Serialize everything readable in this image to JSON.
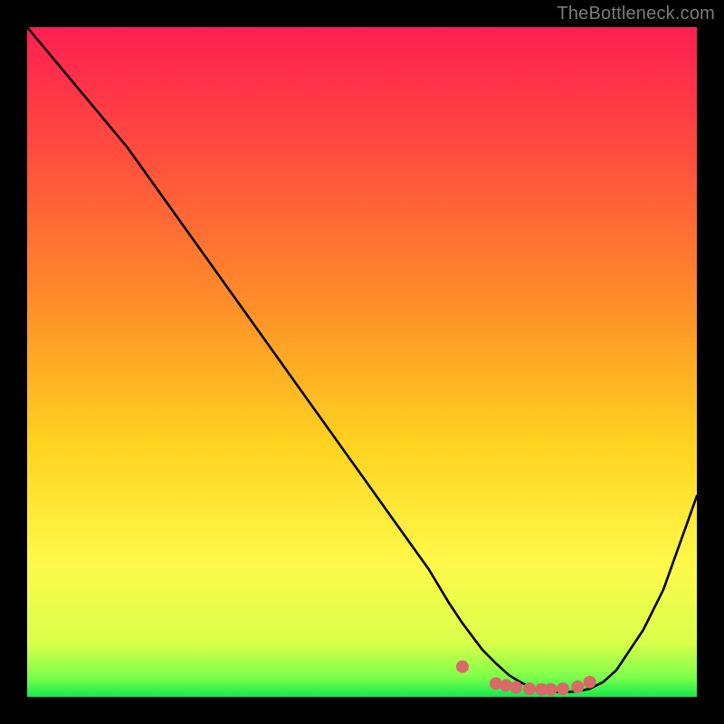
{
  "attribution": "TheBottleneck.com",
  "chart_data": {
    "type": "line",
    "title": "",
    "xlabel": "",
    "ylabel": "",
    "xlim": [
      0,
      100
    ],
    "ylim": [
      0,
      100
    ],
    "grid": false,
    "legend": false,
    "series": [
      {
        "name": "curve",
        "color": "#000000",
        "x": [
          0,
          5,
          10,
          15,
          20,
          25,
          30,
          35,
          40,
          45,
          50,
          55,
          60,
          63,
          65,
          68,
          70,
          72,
          74,
          76,
          78,
          80,
          82,
          84,
          86,
          88,
          90,
          92,
          95,
          100
        ],
        "values": [
          100,
          94,
          88,
          82,
          75,
          68,
          61,
          54,
          47,
          40,
          33,
          26,
          19,
          14,
          11,
          7,
          5,
          3.2,
          2.0,
          1.2,
          0.8,
          0.7,
          0.8,
          1.2,
          2.2,
          4.0,
          7.0,
          10,
          16,
          30
        ]
      }
    ],
    "markers": {
      "name": "highlight-dots",
      "color": "#d86a6a",
      "radius": 7,
      "x": [
        65,
        70,
        71.5,
        73,
        75,
        76.8,
        78.2,
        80,
        82.2,
        84
      ],
      "values": [
        4.5,
        2.0,
        1.7,
        1.4,
        1.2,
        1.1,
        1.1,
        1.2,
        1.5,
        2.2
      ]
    },
    "background_gradient": {
      "stops": [
        {
          "offset": 0.0,
          "color": "#ff1f52"
        },
        {
          "offset": 0.18,
          "color": "#ff4a3f"
        },
        {
          "offset": 0.4,
          "color": "#ff8a2a"
        },
        {
          "offset": 0.62,
          "color": "#ffd21f"
        },
        {
          "offset": 0.8,
          "color": "#fff94a"
        },
        {
          "offset": 0.92,
          "color": "#d9ff4a"
        },
        {
          "offset": 0.97,
          "color": "#7dff4a"
        },
        {
          "offset": 1.0,
          "color": "#15e84d"
        }
      ]
    }
  }
}
